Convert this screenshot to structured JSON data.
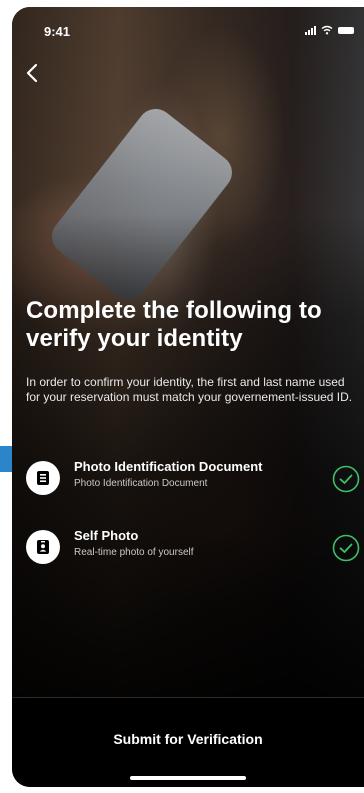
{
  "status_bar": {
    "time": "9:41",
    "icons": [
      "signal-icon",
      "wifi-icon",
      "battery-icon"
    ]
  },
  "nav": {
    "back_icon": "chevron-left-icon"
  },
  "main": {
    "headline": "Complete the following to verify your identity",
    "intro": "In order to confirm your identity, the first and last name used for your reservation must match your governement-issued ID."
  },
  "steps": [
    {
      "icon": "id-document-icon",
      "title": "Photo Identification Document",
      "subtitle": "Photo Identification Document",
      "status_icon": "check-circle-icon"
    },
    {
      "icon": "selfie-badge-icon",
      "title": "Self Photo",
      "subtitle": "Real-time photo of yourself",
      "status_icon": "check-circle-icon"
    }
  ],
  "footer": {
    "submit_label": "Submit for Verification"
  },
  "colors": {
    "check_green": "#3fbf6a",
    "accent_blue": "#2a86c9",
    "background": "#000000",
    "text": "#ffffff"
  }
}
